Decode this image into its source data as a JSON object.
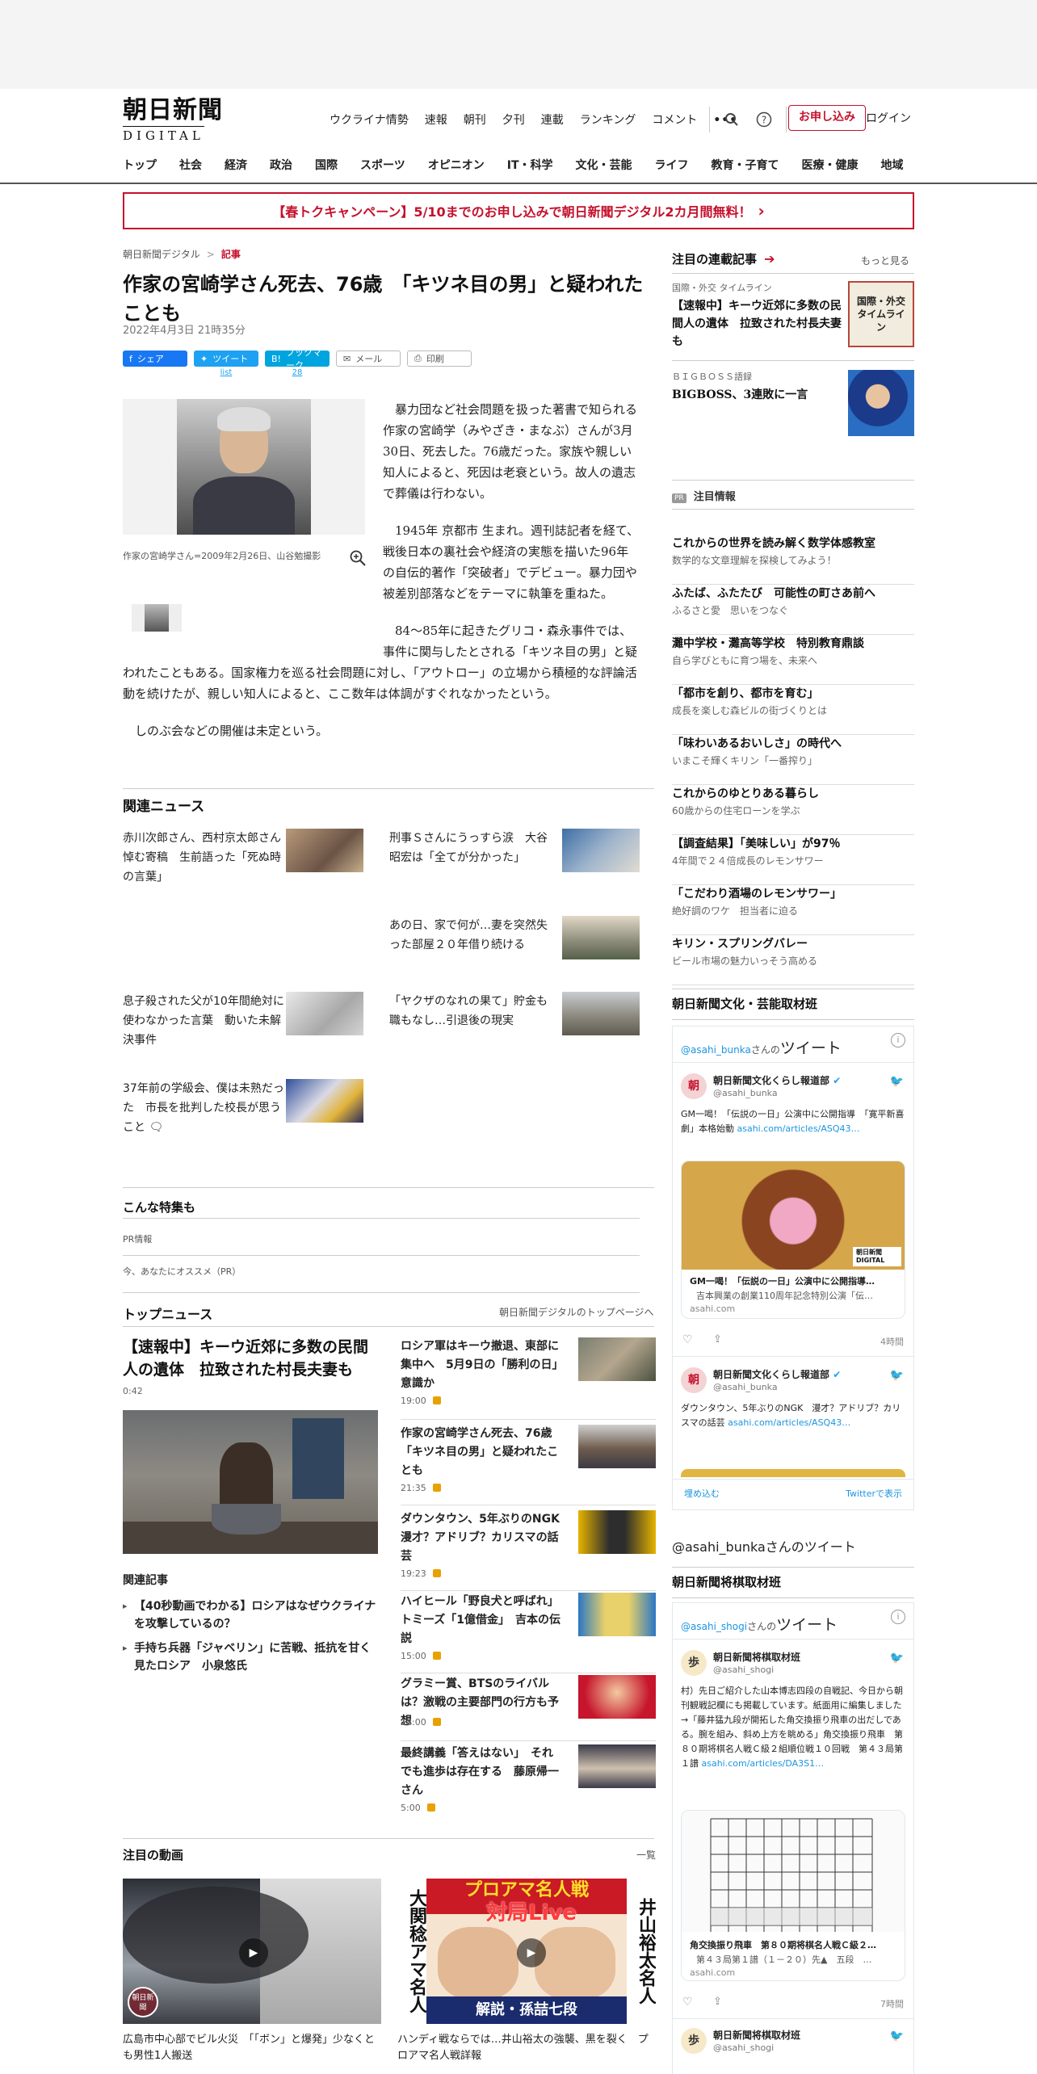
{
  "header": {
    "logo_jp": "朝日新聞",
    "logo_en": "DIGITAL",
    "top_nav": [
      "ウクライナ情勢",
      "速報",
      "朝刊",
      "夕刊",
      "連載",
      "ランキング",
      "コメント"
    ],
    "more_label": "•••",
    "subscribe_label": "お申し込み",
    "login_label": "ログイン",
    "main_nav": [
      "トップ",
      "社会",
      "経済",
      "政治",
      "国際",
      "スポーツ",
      "オピニオン",
      "IT・科学",
      "文化・芸能",
      "ライフ",
      "教育・子育て",
      "医療・健康",
      "地域"
    ]
  },
  "campaign": {
    "text": "【春トクキャンペーン】5/10までのお申し込みで朝日新聞デジタル2カ月間無料！",
    "arrow": "›"
  },
  "article": {
    "breadcrumb_home": "朝日新聞デジタル",
    "breadcrumb_sep": ">",
    "breadcrumb_current": "記事",
    "title": "作家の宮崎学さん死去、76歳　「キツネ目の男」と疑われたことも",
    "date": "2022年4月3日 21時35分",
    "share": {
      "facebook": "シェア",
      "twitter": "ツイート",
      "twitter_count": "list",
      "hatena": "ブックマーク",
      "hatena_count": "28",
      "mail": "メール",
      "print": "印刷"
    },
    "photo_caption": "作家の宮崎学さん=2009年2月26日、山谷勉撮影",
    "paragraphs": [
      "暴力団など社会問題を扱った著書で知られる作家の宮崎学（みやざき・まなぶ）さんが3月30日、死去した。76歳だった。家族や親しい知人によると、死因は老衰という。故人の遺志で葬儀は行わない。",
      "1945年 京都市 生まれ。週刊誌記者を経て、戦後日本の裏社会や経済の実態を描いた96年の自伝的著作「突破者」でデビュー。暴力団や被差別部落などをテーマに執筆を重ねた。",
      "84～85年に起きたグリコ・森永事件では、事件に関与したとされる「キツネ目の男」と疑われたこともある。国家権力を巡る社会問題に対し、「アウトロー」の立場から積極的な評論活動を続けたが、親しい知人によると、ここ数年は体調がすぐれなかったという。",
      "しのぶ会などの開催は未定という。"
    ]
  },
  "related_news": {
    "heading": "関連ニュース",
    "items": [
      "赤川次郎さん、西村京太郎さん悼む寄稿　生前語った「死ぬ時の言葉」",
      "刑事Ｓさんにうっすら涙　大谷昭宏は「全てが分かった」",
      "あの日、家で何が…妻を突然失った部屋２０年借り続ける",
      "息子殺された父が10年間絶対に使わなかった言葉　動いた未解決事件",
      "「ヤクザのなれの果て」貯金も職もなし…引退後の現実",
      "37年前の学級会、僕は未熟だった　市長を批判した校長が思うこと"
    ]
  },
  "tokusyu": {
    "heading": "こんな特集も",
    "pr_label": "PR情報",
    "osusume_label": "今、あなたにオススメ（PR）"
  },
  "top_news": {
    "heading": "トップニュース",
    "link": "朝日新聞デジタルのトップページへ",
    "lead_title": "【速報中】キーウ近郊に多数の民間人の遺体　拉致された村長夫妻も",
    "lead_time": "0:42",
    "related_heading": "関連記事",
    "related_links": [
      "【40秒動画でわかる】ロシアはなぜウクライナを攻撃しているの？",
      "手持ち兵器「ジャベリン」に苦戦、抵抗を甘く見たロシア　小泉悠氏"
    ],
    "items": [
      {
        "title": "ロシア軍はキーウ撤退、東部に集中へ　5月9日の「勝利の日」意識か",
        "time": "19:00"
      },
      {
        "title": "作家の宮崎学さん死去、76歳　「キツネ目の男」と疑われたことも",
        "time": "21:35"
      },
      {
        "title": "ダウンタウン、5年ぶりのNGK漫才？アドリブ？カリスマの話芸",
        "time": "19:23"
      },
      {
        "title": "ハイヒール「野良犬と呼ばれ」トミーズ「1億借金」　吉本の伝説",
        "time": "15:00"
      },
      {
        "title": "グラミー賞、BTSのライバルは？激戦の主要部門の行方も予想",
        "time": "18:00"
      },
      {
        "title": "最終講義「答えはない」　それでも進歩は存在する　藤原帰一さん",
        "time": "5:00"
      }
    ]
  },
  "videos": {
    "heading": "注目の動画",
    "more": "一覧",
    "items": [
      {
        "caption": "広島市中心部でビル火災　「「ボン」と爆発」少なくとも男性1人搬送",
        "badge": "朝日新聞"
      },
      {
        "caption": "ハンディ戦ならでは…井山裕太の強襲、黒を裂く　プロアマ名人戦詳報",
        "banner": "プロアマ名人戦",
        "banner2": "対局Live",
        "left_text": "大関稔アマ名人",
        "right_text": "井山裕太名人",
        "bottom_text": "解説・孫喆七段"
      }
    ]
  },
  "right": {
    "series_heading": "注目の連載記事",
    "series_more": "もっと見る",
    "series": [
      {
        "category": "国際・外交 タイムライン",
        "title": "【速報中】キーウ近郊に多数の民間人の遺体　拉致された村長夫妻も",
        "thumb_text": "国際・外交 タイムライン"
      },
      {
        "category": "ＢＩＧＢＯＳＳ語録",
        "title": "BIGBOSS、3連敗に一言"
      }
    ],
    "pr_badge": "PR",
    "pr_heading": "注目情報",
    "pr_items": [
      {
        "title": "これからの世界を読み解く数学体感教室",
        "sub": "数学的な文章理解を探検してみよう！"
      },
      {
        "title": "ふたば、ふたたび　可能性の町さあ前へ",
        "sub": "ふるさと愛　思いをつなぐ"
      },
      {
        "title": "灘中学校・灘高等学校　特別教育鼎談",
        "sub": "自ら学びともに育つ場を、未来へ"
      },
      {
        "title": "「都市を創り、都市を育む」",
        "sub": "成長を楽しむ森ビルの街づくりとは"
      },
      {
        "title": "「味わいあるおいしさ」の時代へ",
        "sub": "いまこそ輝くキリン「一番搾り」"
      },
      {
        "title": "これからのゆとりある暮らし",
        "sub": "60歳からの住宅ローンを学ぶ"
      },
      {
        "title": "【調査結果】「美味しい」が97％",
        "sub": "4年間で２４倍成長のレモンサワー"
      },
      {
        "title": "「こだわり酒場のレモンサワー」",
        "sub": "絶好調のワケ　担当者に迫る"
      },
      {
        "title": "キリン・スプリングバレー",
        "sub": "ビール市場の魅力いっそう高める"
      }
    ],
    "bunka_heading": "朝日新聞文化・芸能取材班",
    "bunka_tw": {
      "handle": "@asahi_bunka",
      "handle_suffix": "さんの",
      "heading": "ツイート",
      "avatar": "朝",
      "name": "朝日新聞文化くらし報道部",
      "at": "@asahi_bunka",
      "tweet1": "GM一喝！「伝説の一日」公演中に公開指導　「寛平新喜劇」本格始動",
      "tweet1_link": "asahi.com/articles/ASQ43…",
      "card_title": "GM一喝！「伝説の一日」公演中に公開指導…",
      "card_sub": "吉本興業の創業110周年記念特別公演「伝…",
      "card_domain": "asahi.com",
      "card_badge": "朝日新聞 DIGITAL",
      "time": "4時間",
      "tweet2": "ダウンタウン、5年ぶりのNGK　漫才？アドリブ？カリスマの話芸",
      "tweet2_link": "asahi.com/articles/ASQ43…",
      "embed": "埋め込む",
      "view_on": "Twitterで表示"
    },
    "bunka_footer": "@asahi_bunkaさんのツイート",
    "shogi_heading": "朝日新聞将棋取材班",
    "shogi_tw": {
      "handle": "@asahi_shogi",
      "handle_suffix": "さんの",
      "heading": "ツイート",
      "avatar": "歩",
      "name": "朝日新聞将棋取材班",
      "at": "@asahi_shogi",
      "tweet": "村）先日ご紹介した山本博志四段の自戦記、今日から朝刊観戦記欄にも掲載しています。紙面用に編集しました→「藤井猛九段が開拓した角交換振り飛車の出だしである。腕を組み、斜め上方を眺める」角交換振り飛車　第８０期将棋名人戦Ｃ級２組順位戦１０回戦　第４３局第１譜",
      "tweet_link": "asahi.com/articles/DA3S1…",
      "card_title": "角交換振り飛車　第８０期将棋名人戦Ｃ級２…",
      "card_sub": "第４３局第１譜（１－２０）先▲　五段　…",
      "card_domain": "asahi.com",
      "time": "7時間",
      "name2": "朝日新聞将棋取材班",
      "at2": "@asahi_shogi"
    }
  }
}
